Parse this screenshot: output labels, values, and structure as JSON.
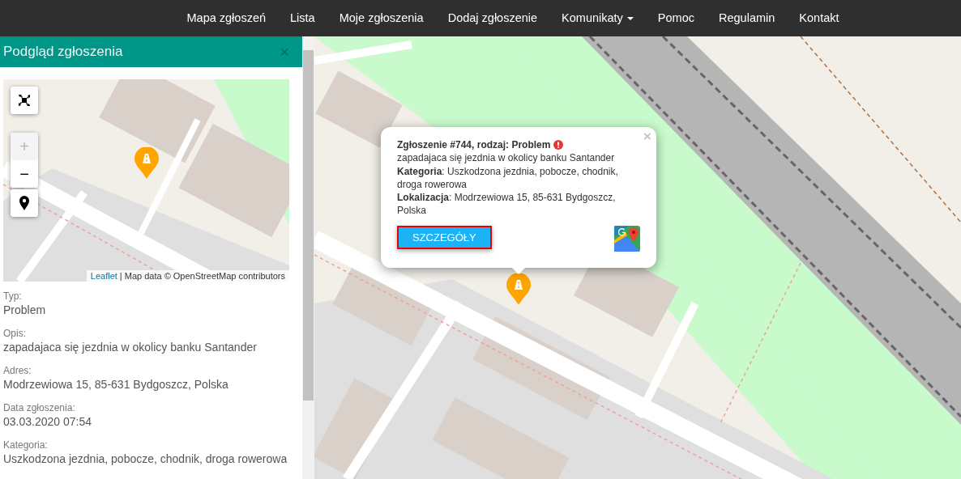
{
  "nav": {
    "items": [
      {
        "label": "Mapa zgłoszeń",
        "kind": "link"
      },
      {
        "label": "Lista",
        "kind": "link"
      },
      {
        "label": "Moje zgłoszenia",
        "kind": "link"
      },
      {
        "label": "Dodaj zgłoszenie",
        "kind": "link"
      },
      {
        "label": "Komunikaty",
        "kind": "dropdown"
      },
      {
        "label": "Pomoc",
        "kind": "link"
      },
      {
        "label": "Regulamin",
        "kind": "link"
      },
      {
        "label": "Kontakt",
        "kind": "link"
      }
    ]
  },
  "panel": {
    "title": "Podgląd zgłoszenia",
    "close": "×",
    "minimap": {
      "controls": [
        {
          "kind": "fullscreen",
          "disabled": false
        },
        {
          "kind": "zoom-in",
          "label": "+",
          "disabled": true
        },
        {
          "kind": "zoom-out",
          "label": "−",
          "disabled": false
        },
        {
          "kind": "locate",
          "disabled": false
        }
      ],
      "attribution_link": "Leaflet",
      "attribution": "| Map data © OpenStreetMap contributors"
    },
    "fields": [
      {
        "label": "Typ:",
        "value": "Problem"
      },
      {
        "label": "Opis:",
        "value": "zapadajaca się jezdnia w okolicy banku Santander"
      },
      {
        "label": "Adres:",
        "value": "Modrzewiowa 15, 85-631 Bydgoszcz, Polska"
      },
      {
        "label": "Data zgłoszenia:",
        "value": "03.03.2020 07:54"
      },
      {
        "label": "Kategoria:",
        "value": "Uszkodzona jezdnia, pobocze, chodnik, droga rowerowa"
      }
    ]
  },
  "popup": {
    "title": "Zgłoszenie #744, rodzaj: Problem",
    "close": "×",
    "lines": [
      "zapadajaca się jezdnia w okolicy banku Santander",
      "**Kategoria**: Uszkodzona jezdnia, pobocze, chodnik, droga rowerowa",
      "**Lokalizacja**: Modrzewiowa 15, 85-631 Bydgoszcz, Polska"
    ],
    "button": "SZCZEGÓŁY"
  }
}
